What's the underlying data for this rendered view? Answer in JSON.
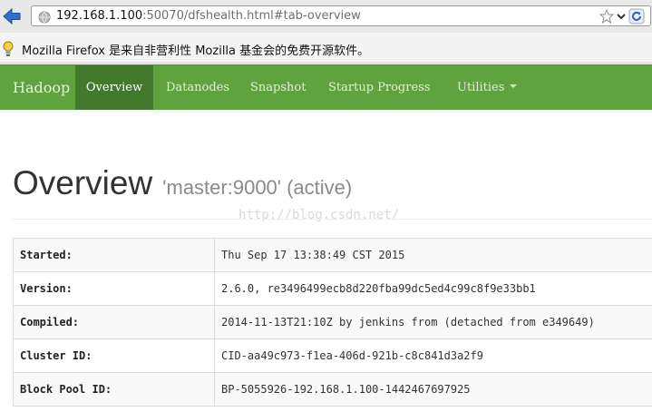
{
  "browser": {
    "url_host": "192.168.1.100",
    "url_rest": ":50070/dfshealth.html#tab-overview",
    "notification": "Mozilla Firefox 是来自非营利性 Mozilla 基金会的免费开源软件。"
  },
  "navbar": {
    "brand": "Hadoop",
    "items": [
      {
        "label": "Overview",
        "active": true
      },
      {
        "label": "Datanodes"
      },
      {
        "label": "Snapshot"
      },
      {
        "label": "Startup Progress"
      },
      {
        "label": "Utilities",
        "has_dropdown": true
      }
    ]
  },
  "overview": {
    "title": "Overview",
    "subtitle": "'master:9000' (active)",
    "watermark": "http://blog.csdn.net/",
    "rows": [
      {
        "key": "Started:",
        "value": "Thu Sep 17 13:38:49 CST 2015"
      },
      {
        "key": "Version:",
        "value": "2.6.0, re3496499ecb8d220fba99dc5ed4c99c8f9e33bb1"
      },
      {
        "key": "Compiled:",
        "value": "2014-11-13T21:10Z by jenkins from (detached from e349649)"
      },
      {
        "key": "Cluster ID:",
        "value": "CID-aa49c973-f1ea-406d-921b-c8c841d3a2f9"
      },
      {
        "key": "Block Pool ID:",
        "value": "BP-5055926-192.168.1.100-1442467697925"
      }
    ]
  },
  "colors": {
    "navbar": "#5fa33e",
    "navbar_active": "#43792d"
  }
}
